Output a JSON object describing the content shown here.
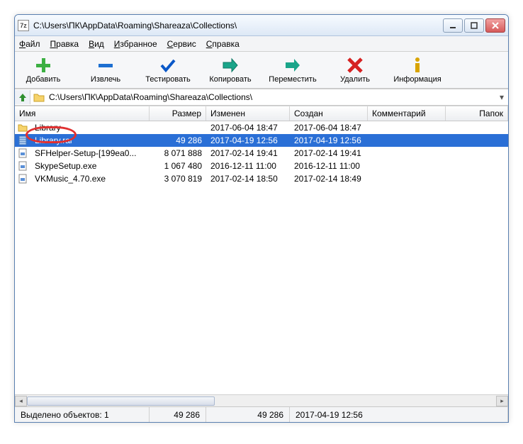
{
  "title": "C:\\Users\\ПК\\AppData\\Roaming\\Shareaza\\Collections\\",
  "app_icon_label": "7z",
  "menu": {
    "file": {
      "u": "Ф",
      "rest": "айл"
    },
    "edit": {
      "u": "П",
      "rest": "равка"
    },
    "view": {
      "u": "В",
      "rest": "ид"
    },
    "fav": {
      "u": "И",
      "rest": "збранное"
    },
    "tools": {
      "u": "С",
      "rest": "ервис"
    },
    "help": {
      "u": "С",
      "rest": "правка"
    }
  },
  "toolbar": {
    "add": "Добавить",
    "extract": "Извлечь",
    "test": "Тестировать",
    "copy": "Копировать",
    "move": "Переместить",
    "delete": "Удалить",
    "info": "Информация"
  },
  "address": {
    "path": "C:\\Users\\ПК\\AppData\\Roaming\\Shareaza\\Collections\\"
  },
  "columns": {
    "name": "Имя",
    "size": "Размер",
    "modified": "Изменен",
    "created": "Создан",
    "comment": "Комментарий",
    "folders": "Папок"
  },
  "files": [
    {
      "icon": "folder",
      "name": "Library",
      "size": "",
      "modified": "2017-06-04 18:47",
      "created": "2017-06-04 18:47",
      "selected": false
    },
    {
      "icon": "rar",
      "name": "Library.rar",
      "size": "49 286",
      "modified": "2017-04-19 12:56",
      "created": "2017-04-19 12:56",
      "selected": true
    },
    {
      "icon": "exe",
      "name": "SFHelper-Setup-[199ea0...",
      "size": "8 071 888",
      "modified": "2017-02-14 19:41",
      "created": "2017-02-14 19:41",
      "selected": false
    },
    {
      "icon": "exe",
      "name": "SkypeSetup.exe",
      "size": "1 067 480",
      "modified": "2016-12-11 11:00",
      "created": "2016-12-11 11:00",
      "selected": false
    },
    {
      "icon": "exe",
      "name": "VKMusic_4.70.exe",
      "size": "3 070 819",
      "modified": "2017-02-14 18:50",
      "created": "2017-02-14 18:49",
      "selected": false
    }
  ],
  "status": {
    "selected_label": "Выделено объектов: 1",
    "size": "49 286",
    "size2": "49 286",
    "date": "2017-04-19 12:56"
  },
  "colors": {
    "selection_bg": "#2a6fd6",
    "highlight_ring": "#e03030"
  }
}
